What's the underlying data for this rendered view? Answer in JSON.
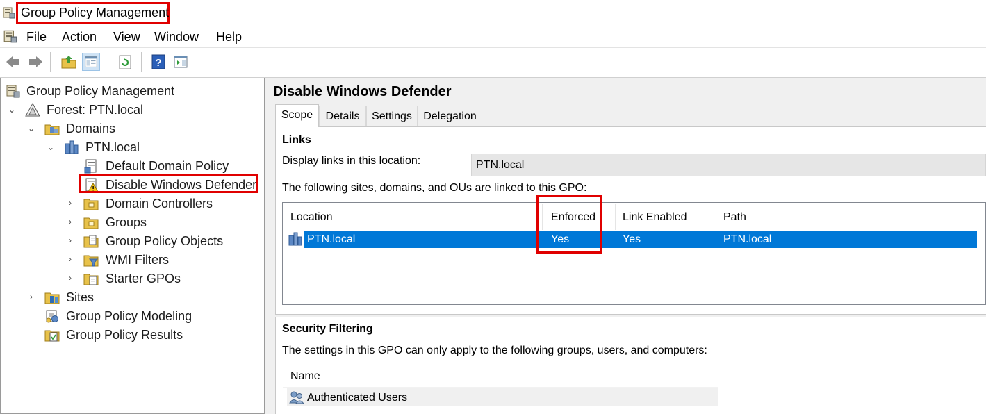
{
  "window": {
    "title": "Group Policy Management"
  },
  "menu": [
    "File",
    "Action",
    "View",
    "Window",
    "Help"
  ],
  "toolbar": {
    "icons": [
      "back-arrow-icon",
      "forward-arrow-icon",
      "up-folder-icon",
      "show-hide-console-tree-icon",
      "refresh-icon",
      "help-icon",
      "action-pane-icon"
    ]
  },
  "tree": {
    "root": "Group Policy Management",
    "forest": "Forest: PTN.local",
    "domains": "Domains",
    "domain": "PTN.local",
    "items": [
      "Default Domain Policy",
      "Disable Windows Defender",
      "Domain Controllers",
      "Groups",
      "Group Policy Objects",
      "WMI Filters",
      "Starter GPOs"
    ],
    "sites": "Sites",
    "modeling": "Group Policy Modeling",
    "results": "Group Policy Results"
  },
  "details": {
    "title": "Disable Windows Defender",
    "tabs": [
      "Scope",
      "Details",
      "Settings",
      "Delegation"
    ],
    "active_tab": "Scope",
    "links": {
      "heading": "Links",
      "location_label": "Display links in this location:",
      "location_value": "PTN.local",
      "linked_caption": "The following sites, domains, and OUs are linked to this GPO:",
      "columns": [
        "Location",
        "Enforced",
        "Link Enabled",
        "Path"
      ],
      "rows": [
        {
          "location": "PTN.local",
          "enforced": "Yes",
          "link_enabled": "Yes",
          "path": "PTN.local"
        }
      ]
    },
    "security": {
      "heading": "Security Filtering",
      "caption": "The settings in this GPO can only apply to the following groups, users, and computers:",
      "column": "Name",
      "rows": [
        "Authenticated Users"
      ]
    }
  },
  "colors": {
    "highlight_red": "#e00000",
    "selection_blue": "#0078d7"
  }
}
